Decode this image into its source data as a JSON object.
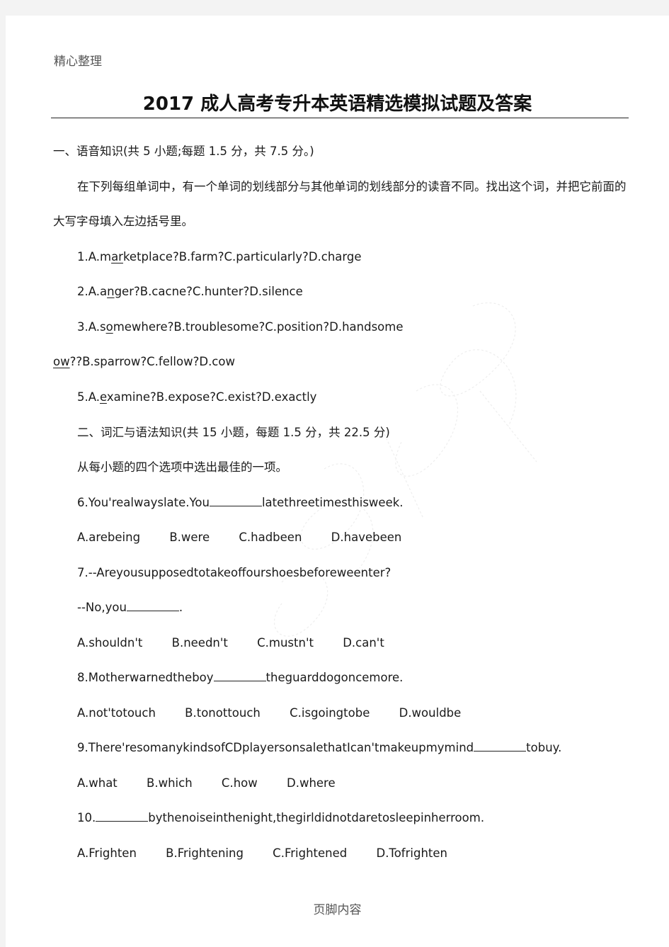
{
  "header": {
    "text": "精心整理"
  },
  "title": "2017 成人高考专升本英语精选模拟试题及答案",
  "section1": {
    "heading": "一、语音知识(共 5 小题;每题 1.5 分，共 7.5 分。)",
    "instruction_line1": "在下列每组单词中，有一个单词的划线部分与其他单词的划线部分的读音不同。找出这个词，并把它前面的",
    "instruction_line2": "大写字母填入左边括号里。",
    "items": [
      {
        "pre": "1.A.m",
        "u": "ar",
        "post": "ketplace?B.farm?C.particularly?D.charge"
      },
      {
        "pre": "2.A.a",
        "u": "n",
        "post": "ger?B.cacne?C.hunter?D.silence"
      },
      {
        "pre": "3.A.s",
        "u": "o",
        "post": "mewhere?B.troublesome?C.position?D.handsome"
      },
      {
        "pre": "",
        "u": "ow",
        "post": "??B.sparrow?C.fellow?D.cow"
      },
      {
        "pre": "5.A.",
        "u": "e",
        "post": "xamine?B.expose?C.exist?D.exactly"
      }
    ]
  },
  "section2": {
    "heading": "二、词汇与语法知识(共 15 小题，每题 1.5 分，共 22.5 分)",
    "instruction": "从每小题的四个选项中选出最佳的一项。",
    "questions": [
      {
        "stem_pre": "6.You'realwayslate.You",
        "stem_post": "latethreetimesthisweek.",
        "options": [
          "A.arebeing",
          "B.were",
          "C.hadbeen",
          "D.havebeen"
        ]
      },
      {
        "stem_line1": "7.--Areyousupposedtotakeoffourshoesbeforeweenter?",
        "stem_pre": "--No,you",
        "stem_post": ".",
        "options": [
          "A.shouldn't",
          "B.needn't",
          "C.mustn't",
          "D.can't"
        ]
      },
      {
        "stem_pre": "8.Motherwarnedtheboy",
        "stem_post": "theguarddogoncemore.",
        "options": [
          "A.not'totouch",
          "B.tonottouch",
          "C.isgoingtobe",
          "D.wouldbe"
        ]
      },
      {
        "stem_pre": "9.There'resomanykindsofCDplayersonsalethatIcan'tmakeupmymind",
        "stem_post": "tobuy.",
        "options": [
          "A.what",
          "B.which",
          "C.how",
          "D.where"
        ]
      },
      {
        "stem_pre": "10.",
        "stem_post": "bythenoiseinthenight,thegirldidnotdaretosleepinherroom.",
        "options": [
          "A.Frighten",
          "B.Frightening",
          "C.Frightened",
          "D.Tofrighten"
        ]
      }
    ]
  },
  "footer": {
    "text": "页脚内容"
  }
}
